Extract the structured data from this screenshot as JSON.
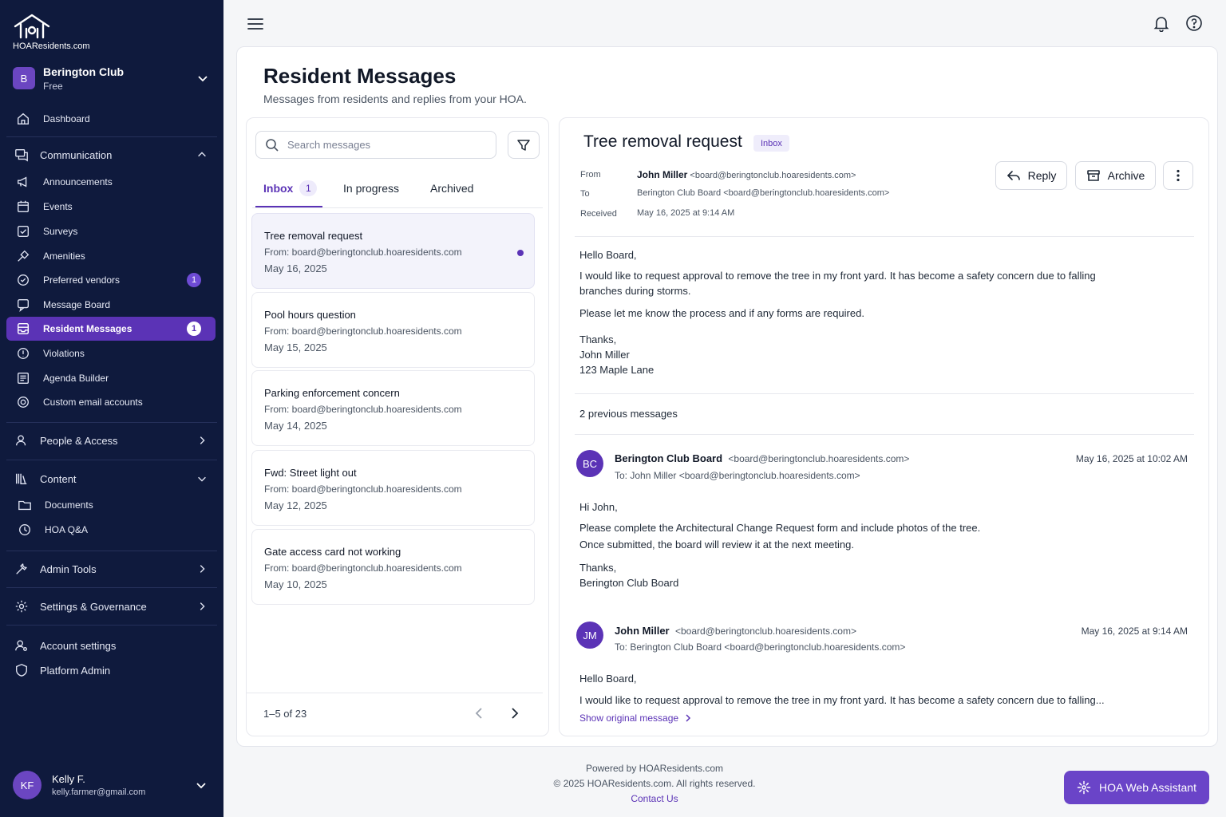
{
  "brand": {
    "site": "HOAResidents.com"
  },
  "org": {
    "initial": "B",
    "name": "Berington Club",
    "plan": "Free"
  },
  "sidebar": {
    "dashboard": "Dashboard",
    "communication": {
      "label": "Communication",
      "items": [
        {
          "label": "Announcements"
        },
        {
          "label": "Events"
        },
        {
          "label": "Surveys"
        },
        {
          "label": "Amenities"
        },
        {
          "label": "Preferred vendors",
          "badge": "1"
        },
        {
          "label": "Message Board"
        },
        {
          "label": "Resident Messages",
          "badge": "1"
        },
        {
          "label": "Violations"
        },
        {
          "label": "Agenda Builder"
        },
        {
          "label": "Custom email accounts"
        }
      ]
    },
    "people_access": "People & Access",
    "content": {
      "label": "Content",
      "items": [
        {
          "label": "Documents"
        },
        {
          "label": "HOA Q&A"
        }
      ]
    },
    "admin_tools": "Admin Tools",
    "settings_governance": "Settings & Governance",
    "account_settings": "Account settings",
    "platform_admin": "Platform Admin"
  },
  "user": {
    "initials": "KF",
    "name": "Kelly F.",
    "email": "kelly.farmer@gmail.com"
  },
  "page": {
    "title": "Resident Messages",
    "subtitle": "Messages from residents and replies from your HOA."
  },
  "list": {
    "search_placeholder": "Search messages",
    "tabs": [
      {
        "label": "Inbox",
        "count": "1"
      },
      {
        "label": "In progress"
      },
      {
        "label": "Archived"
      }
    ],
    "messages": [
      {
        "subject": "Tree removal request",
        "from": "From: board@beringtonclub.hoaresidents.com",
        "date": "May 16, 2025"
      },
      {
        "subject": "Pool hours question",
        "from": "From: board@beringtonclub.hoaresidents.com",
        "date": "May 15, 2025"
      },
      {
        "subject": "Parking enforcement concern",
        "from": "From: board@beringtonclub.hoaresidents.com",
        "date": "May 14, 2025"
      },
      {
        "subject": "Fwd: Street light out",
        "from": "From: board@beringtonclub.hoaresidents.com",
        "date": "May 12, 2025"
      },
      {
        "subject": "Gate access card not working",
        "from": "From: board@beringtonclub.hoaresidents.com",
        "date": "May 10, 2025"
      }
    ],
    "pager": "1–5 of 23"
  },
  "detail": {
    "title": "Tree removal request",
    "tag": "Inbox",
    "from_label": "From",
    "from_name": "John Miller",
    "from_email": "<board@beringtonclub.hoaresidents.com>",
    "to_label": "To",
    "to_value": "Berington Club Board <board@beringtonclub.hoaresidents.com>",
    "received_label": "Received",
    "received_value": "May 16, 2025 at 9:14 AM",
    "reply_label": "Reply",
    "archive_label": "Archive",
    "body": {
      "greeting": "Hello Board,",
      "p1a": "I would like to request approval to remove the tree in my front yard. It has become a safety concern due to falling",
      "p1b": "branches during storms.",
      "p2": "Please let me know the process and if any forms are required.",
      "sign1": "Thanks,",
      "sign2": "John Miller",
      "sign3": "123 Maple Lane"
    },
    "previous_label": "2 previous messages",
    "thread": [
      {
        "initials": "BC",
        "name": "Berington Club Board",
        "email": "<board@beringtonclub.hoaresidents.com>",
        "to": "To: John Miller  <board@beringtonclub.hoaresidents.com>",
        "date": "May 16, 2025 at 10:02 AM",
        "greeting": "Hi John,",
        "l1": "Please complete the Architectural Change Request form and include photos of the tree.",
        "l2": "Once submitted, the board will review it at the next meeting.",
        "s1": "Thanks,",
        "s2": "Berington Club Board"
      },
      {
        "initials": "JM",
        "name": "John Miller",
        "email": "<board@beringtonclub.hoaresidents.com>",
        "to": "To: Berington Club Board <board@beringtonclub.hoaresidents.com>",
        "date": "May 16, 2025 at 9:14 AM",
        "greeting": "Hello Board,",
        "l1": "I would like to request approval to remove the tree in my front yard. It has become a safety concern due to falling...",
        "show_original": "Show original message"
      }
    ]
  },
  "footer": {
    "powered": "Powered by HOAResidents.com",
    "copyright": "© 2025 HOAResidents.com. All rights reserved.",
    "contact": "Contact Us"
  },
  "assistant_label": "HOA Web Assistant",
  "colors": {
    "sidebar_bg": "#0f1a3d",
    "accent": "#5b33b6",
    "accent_button": "#6a44c8"
  }
}
